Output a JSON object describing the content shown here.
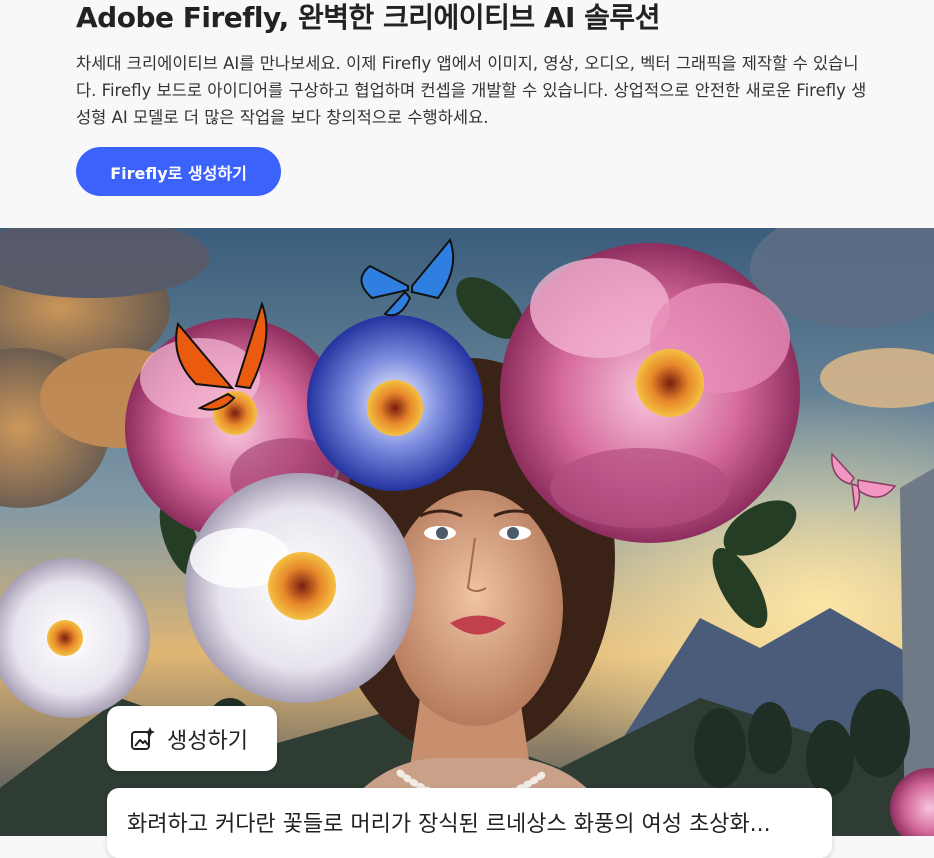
{
  "header": {
    "title": "Adobe Firefly, 완벽한 크리에이티브 AI 솔루션",
    "description": "차세대 크리에이티브 AI를 만나보세요. 이제 Firefly 앱에서 이미지, 영상, 오디오, 벡터 그래픽을 제작할 수 있습니다. Firefly 보드로 아이디어를 구상하고 협업하며 컨셉을 개발할 수 있습니다. 상업적으로 안전한 새로운 Firefly 생성형 AI 모델로 더 많은 작업을 보다 창의적으로 수행하세요.",
    "cta_label": "Firefly로 생성하기"
  },
  "hero": {
    "generate_label": "생성하기",
    "generate_icon": "sparkle-image-icon",
    "prompt_text": "화려하고 커다란 꽃들로 머리가 장식된 르네상스 화풍의 여성 초상화..."
  },
  "colors": {
    "accent": "#3b63fb",
    "background": "#f8f8f8"
  }
}
